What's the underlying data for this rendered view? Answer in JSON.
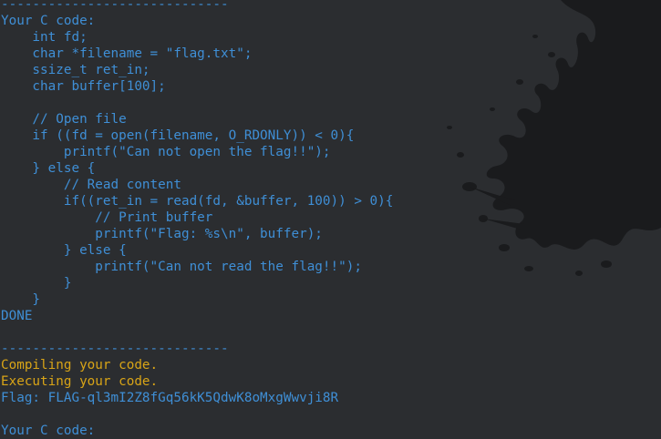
{
  "colors": {
    "background": "#2b2d30",
    "text_blue": "#3f8fd6",
    "text_yellow": "#d8a417",
    "splatter": "#1a1b1d"
  },
  "terminal": {
    "lines": [
      {
        "text": "-----------------------------",
        "color": "blue",
        "name": "separator-line"
      },
      {
        "text": "Your C code:",
        "color": "blue",
        "name": "prompt-line"
      },
      {
        "text": "    int fd;",
        "color": "blue",
        "name": "code-line"
      },
      {
        "text": "    char *filename = \"flag.txt\";",
        "color": "blue",
        "name": "code-line"
      },
      {
        "text": "    ssize_t ret_in;",
        "color": "blue",
        "name": "code-line"
      },
      {
        "text": "    char buffer[100];",
        "color": "blue",
        "name": "code-line"
      },
      {
        "text": "",
        "color": "blue",
        "name": "blank-line"
      },
      {
        "text": "    // Open file",
        "color": "blue",
        "name": "code-line"
      },
      {
        "text": "    if ((fd = open(filename, O_RDONLY)) < 0){",
        "color": "blue",
        "name": "code-line"
      },
      {
        "text": "        printf(\"Can not open the flag!!\");",
        "color": "blue",
        "name": "code-line"
      },
      {
        "text": "    } else {",
        "color": "blue",
        "name": "code-line"
      },
      {
        "text": "        // Read content",
        "color": "blue",
        "name": "code-line"
      },
      {
        "text": "        if((ret_in = read(fd, &buffer, 100)) > 0){",
        "color": "blue",
        "name": "code-line"
      },
      {
        "text": "            // Print buffer",
        "color": "blue",
        "name": "code-line"
      },
      {
        "text": "            printf(\"Flag: %s\\n\", buffer);",
        "color": "blue",
        "name": "code-line"
      },
      {
        "text": "        } else {",
        "color": "blue",
        "name": "code-line"
      },
      {
        "text": "            printf(\"Can not read the flag!!\");",
        "color": "blue",
        "name": "code-line"
      },
      {
        "text": "        }",
        "color": "blue",
        "name": "code-line"
      },
      {
        "text": "    }",
        "color": "blue",
        "name": "code-line"
      },
      {
        "text": "DONE",
        "color": "blue",
        "name": "done-line"
      },
      {
        "text": "",
        "color": "blue",
        "name": "blank-line"
      },
      {
        "text": "-----------------------------",
        "color": "blue",
        "name": "separator-line"
      },
      {
        "text": "Compiling your code.",
        "color": "yellow",
        "name": "status-line"
      },
      {
        "text": "Executing your code.",
        "color": "yellow",
        "name": "status-line"
      },
      {
        "text": "Flag: FLAG-ql3mI2Z8fGq56kK5QdwK8oMxgWwvji8R",
        "color": "blue",
        "name": "flag-output-line"
      },
      {
        "text": "",
        "color": "blue",
        "name": "blank-line"
      },
      {
        "text": "Your C code:",
        "color": "blue",
        "name": "prompt-line"
      }
    ]
  }
}
